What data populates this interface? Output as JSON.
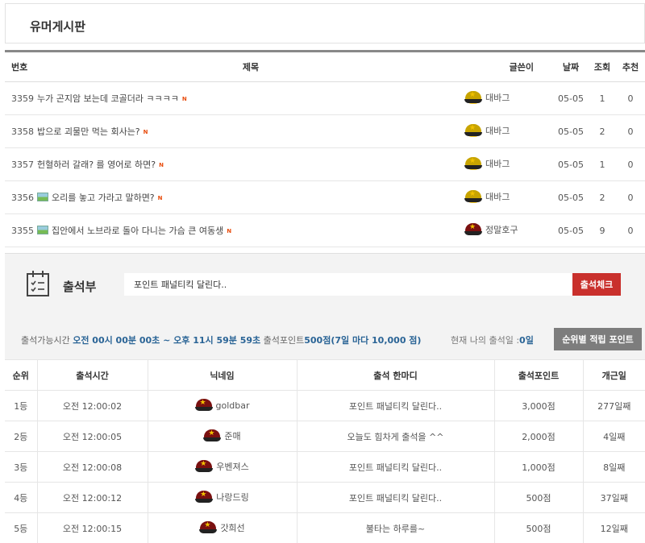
{
  "board": {
    "title": "유머게시판"
  },
  "posts": {
    "headers": {
      "no": "번호",
      "title": "제목",
      "author": "글쓴이",
      "date": "날짜",
      "views": "조회",
      "recommend": "추천"
    },
    "new_badge": "N",
    "rows": [
      {
        "no": "3359",
        "title": "누가 곤지암 보는데 코골더라 ㅋㅋㅋㅋ",
        "has_image": false,
        "author": "대바그",
        "avatar": "yellow-cap-avatar-icon",
        "date": "05-05",
        "views": "1",
        "recommend": "0"
      },
      {
        "no": "3358",
        "title": "밥으로 괴물만 먹는 회사는?",
        "has_image": false,
        "author": "대바그",
        "avatar": "yellow-cap-avatar-icon",
        "date": "05-05",
        "views": "2",
        "recommend": "0"
      },
      {
        "no": "3357",
        "title": "헌혈하러 갈래? 를 영어로 하면?",
        "has_image": false,
        "author": "대바그",
        "avatar": "yellow-cap-avatar-icon",
        "date": "05-05",
        "views": "1",
        "recommend": "0"
      },
      {
        "no": "3356",
        "title": "오리를 놓고 가라고 말하면?",
        "has_image": true,
        "author": "대바그",
        "avatar": "yellow-cap-avatar-icon",
        "date": "05-05",
        "views": "2",
        "recommend": "0"
      },
      {
        "no": "3355",
        "title": "집안에서 노브라로 돌아 다니는 가슴 큰 여동생",
        "has_image": true,
        "author": "정말호구",
        "avatar": "red-cap-avatar-icon",
        "date": "05-05",
        "views": "9",
        "recommend": "0"
      }
    ]
  },
  "attendance": {
    "title": "출석부",
    "input_value": "포인트 패널티킥 달린다..",
    "check_button": "출석체크",
    "info_prefix": "출석가능시간",
    "info_time": "오전 00시 00분 00초 ~ 오후 11시 59분 59초",
    "info_points_label": "출석포인트",
    "info_points": "500점(7일 마다 10,000 점)",
    "my_days_label": "현재 나의 출석일 :",
    "my_days": "0일",
    "rank_button": "순위별 적립 포인트",
    "headers": {
      "rank": "순위",
      "time": "출석시간",
      "nick": "닉네임",
      "say": "출석 한마디",
      "points": "출석포인트",
      "days": "개근일"
    },
    "rows": [
      {
        "rank": "1등",
        "time": "오전 12:00:02",
        "nick": "goldbar",
        "say": "포인트 패널티킥 달린다..",
        "points": "3,000점",
        "days": "277일째"
      },
      {
        "rank": "2등",
        "time": "오전 12:00:05",
        "nick": "준매",
        "say": "오늘도 힘차게 출석을 ^^",
        "points": "2,000점",
        "days": "4일째"
      },
      {
        "rank": "3등",
        "time": "오전 12:00:08",
        "nick": "우벤져스",
        "say": "포인트 패널티킥 달린다..",
        "points": "1,000점",
        "days": "8일째"
      },
      {
        "rank": "4등",
        "time": "오전 12:00:12",
        "nick": "나랑드링",
        "say": "포인트 패널티킥 달린다..",
        "points": "500점",
        "days": "37일째"
      },
      {
        "rank": "5등",
        "time": "오전 12:00:15",
        "nick": "갓희선",
        "say": "불타는 하루를~",
        "points": "500점",
        "days": "12일째"
      }
    ]
  }
}
